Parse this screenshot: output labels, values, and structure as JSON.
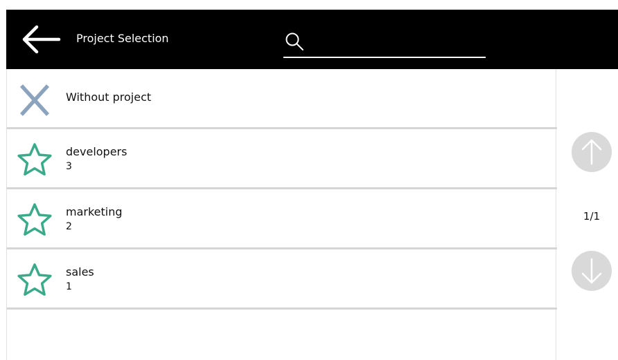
{
  "header": {
    "title": "Project Selection",
    "back_icon": "arrow-left-icon",
    "search": {
      "icon": "search-icon",
      "value": "",
      "placeholder": ""
    }
  },
  "list": {
    "items": [
      {
        "label": "Without project",
        "icon": "close-x-icon"
      },
      {
        "label": "developers",
        "count": "3",
        "icon": "star-icon"
      },
      {
        "label": "marketing",
        "count": "2",
        "icon": "star-icon"
      },
      {
        "label": "sales",
        "count": "1",
        "icon": "star-icon"
      }
    ]
  },
  "pager": {
    "page_indicator": "1/1",
    "up_icon": "arrow-up-icon",
    "down_icon": "arrow-down-icon"
  },
  "colors": {
    "header_bg": "#000000",
    "x_icon": "#8ca3bd",
    "star_icon": "#3aaa8a",
    "pager_button": "#d9d9d9",
    "divider": "#d5d5d5"
  }
}
